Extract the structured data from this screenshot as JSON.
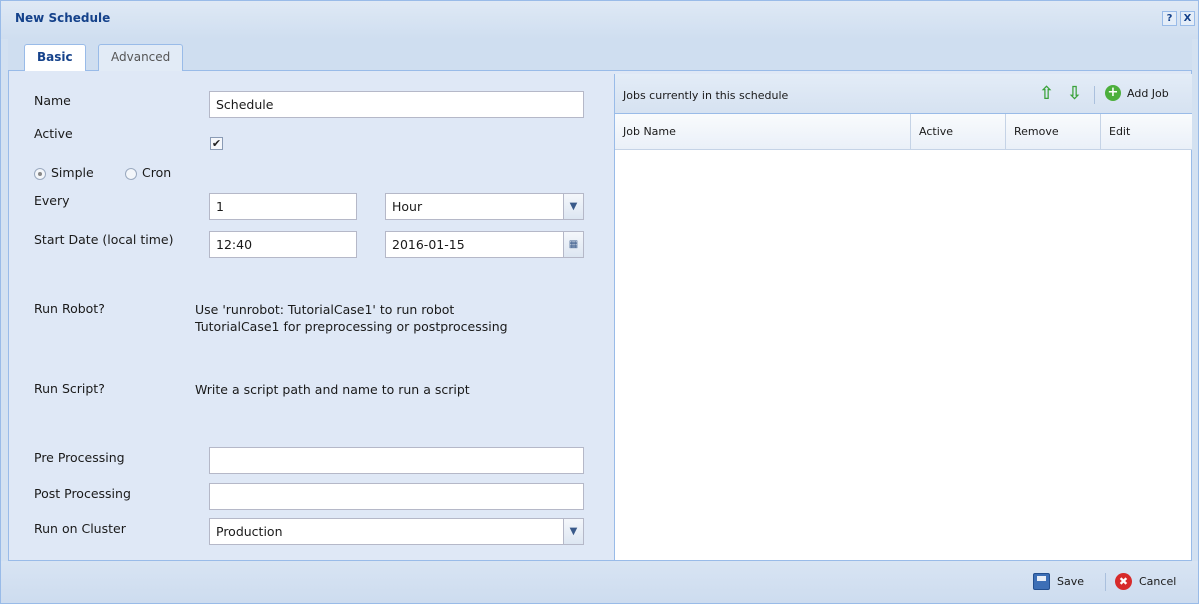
{
  "window": {
    "title": "New Schedule",
    "help_icon": "?",
    "close_icon": "X"
  },
  "tabs": [
    {
      "label": "Basic",
      "active": true
    },
    {
      "label": "Advanced",
      "active": false
    }
  ],
  "form": {
    "name_label": "Name",
    "name_value": "Schedule",
    "active_label": "Active",
    "active_checked": true,
    "mode_options": [
      {
        "label": "Simple",
        "selected": true
      },
      {
        "label": "Cron",
        "selected": false
      }
    ],
    "every_label": "Every",
    "every_value": "1",
    "every_unit": "Hour",
    "start_label": "Start Date (local time)",
    "start_time": "12:40",
    "start_date": "2016-01-15",
    "run_robot_label": "Run Robot?",
    "run_robot_help_line1": "Use 'runrobot: TutorialCase1' to run robot",
    "run_robot_help_line2": "TutorialCase1 for preprocessing or postprocessing",
    "run_script_label": "Run Script?",
    "run_script_help": "Write a script path and name to run a script",
    "pre_label": "Pre Processing",
    "pre_value": "",
    "post_label": "Post Processing",
    "post_value": "",
    "cluster_label": "Run on Cluster",
    "cluster_value": "Production"
  },
  "jobs": {
    "title": "Jobs currently in this schedule",
    "add_label": "Add Job",
    "columns": [
      "Job Name",
      "Active",
      "Remove",
      "Edit"
    ],
    "rows": []
  },
  "footer": {
    "save_label": "Save",
    "cancel_label": "Cancel"
  },
  "icons": {
    "move_up": "arrow-up-icon",
    "move_down": "arrow-down-icon",
    "add": "plus-circle-icon",
    "save": "floppy-disk-icon",
    "cancel": "cancel-circle-icon",
    "calendar": "calendar-icon",
    "dropdown": "chevron-down-icon"
  },
  "colors": {
    "title_text": "#15428b",
    "panel_bg": "#dfe8f6",
    "border": "#99bbe8"
  }
}
